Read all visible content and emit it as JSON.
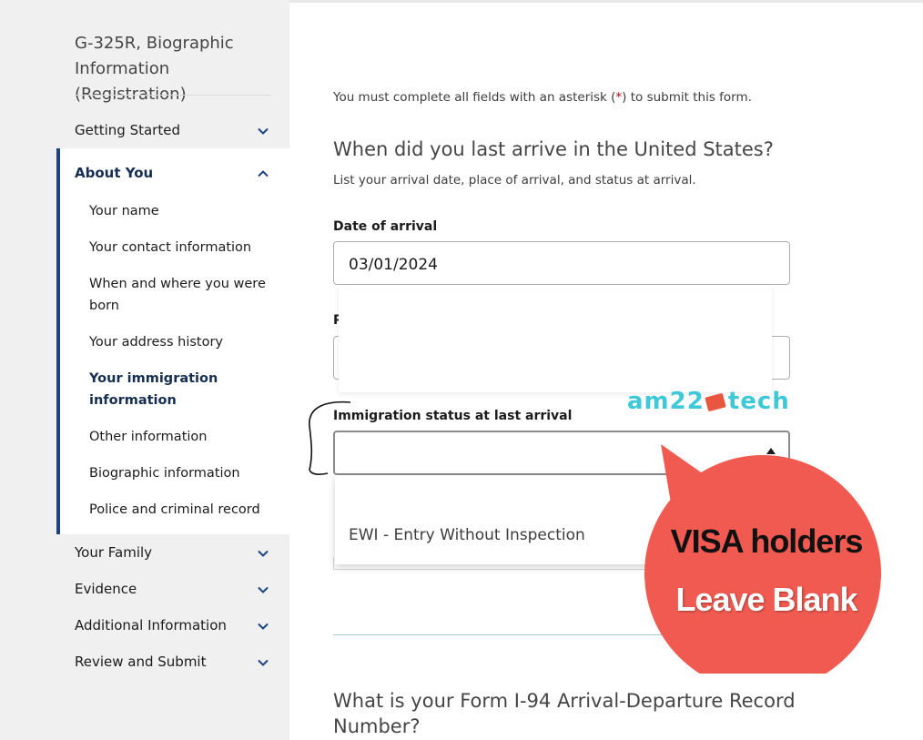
{
  "sidebar": {
    "form_title": "G-325R, Biographic Information (Registration)",
    "sections": {
      "getting_started": "Getting Started",
      "about_you": "About You",
      "your_family": "Your Family",
      "evidence": "Evidence",
      "additional_information": "Additional Information",
      "review_and_submit": "Review and Submit"
    },
    "about_items": [
      "Your name",
      "Your contact information",
      "When and where you were born",
      "Your address history",
      "Your immigration information",
      "Other information",
      "Biographic information",
      "Police and criminal record"
    ],
    "current_item": "Your immigration information"
  },
  "main": {
    "intro_before": "You must complete all fields with an asterisk (",
    "intro_asterisk": "*",
    "intro_after": ") to submit this form.",
    "question1": "When did you last arrive in the United States?",
    "question1_hint": "List your arrival date, place of arrival, and status at arrival.",
    "date_label": "Date of arrival",
    "date_value": "03/01/2024",
    "place_label_fragment": "P",
    "status_label": "Immigration status at last arrival",
    "status_value": "",
    "dropdown_option": "EWI - Entry Without Inspection",
    "question2": "What is your Form I-94 Arrival-Departure Record Number?"
  },
  "overlay": {
    "watermark_left": "am22",
    "watermark_right": "tech",
    "callout_line1": "VISA holders",
    "callout_line2": "Leave Blank",
    "callout_color": "#f05a50"
  },
  "colors": {
    "sidebar_bg": "#f0f0f0",
    "active_bar": "#1a4480",
    "asterisk": "#b50909",
    "watermark": "#3fc9d8"
  }
}
